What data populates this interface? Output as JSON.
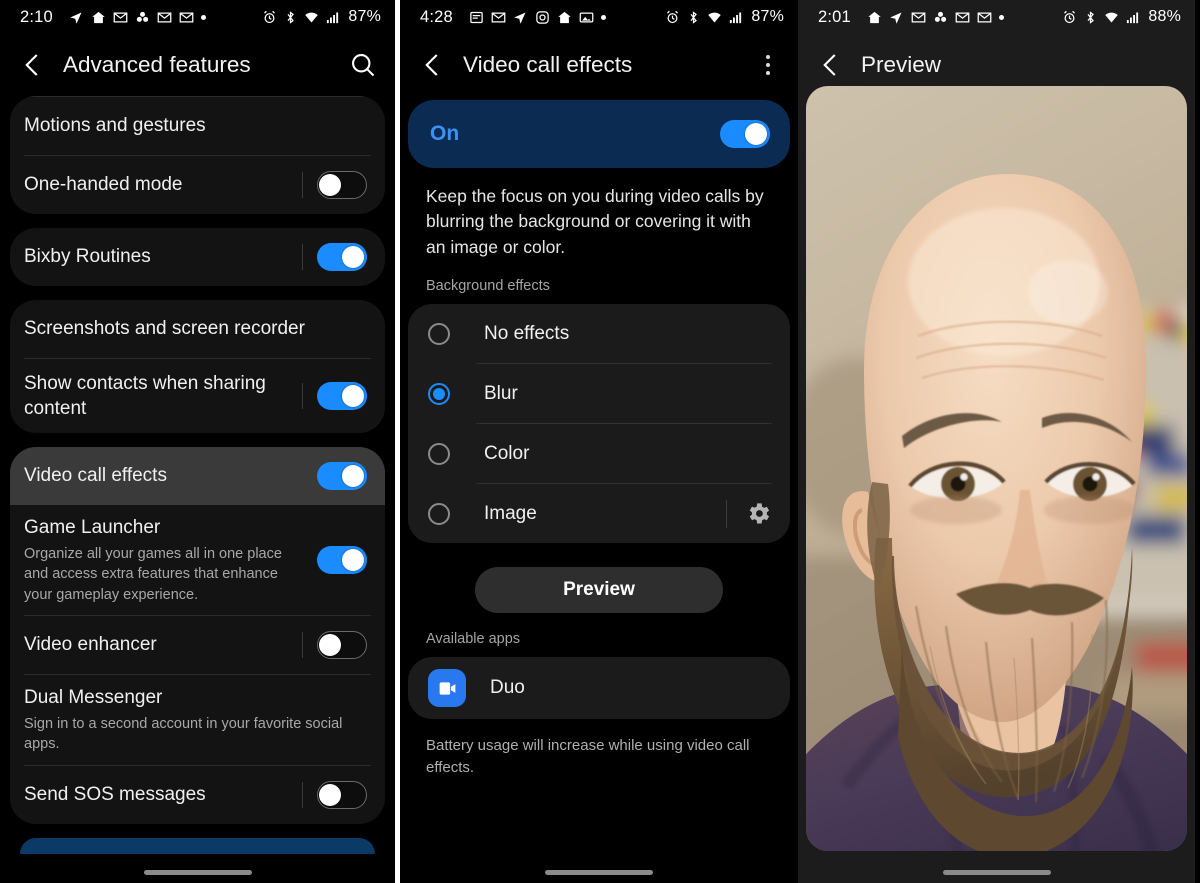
{
  "panels": [
    {
      "status_bar": {
        "time": "2:10",
        "left_icons": [
          "send-icon",
          "home-icon",
          "gmail-icon",
          "flower-icon",
          "gmail-icon",
          "gmail-icon",
          "dot-icon"
        ],
        "right_icons": [
          "alarm-icon",
          "bluetooth-icon",
          "wifi-icon",
          "signal-icon"
        ],
        "battery": "87%"
      },
      "appbar": {
        "title": "Advanced features",
        "back": "back-icon",
        "action": "search-icon"
      },
      "cards": [
        {
          "rows": [
            {
              "title": "Motions and gestures",
              "sub": null,
              "toggle": null,
              "divider_after": true
            },
            {
              "title": "One-handed mode",
              "sub": null,
              "toggle": "off",
              "divider_after": false
            }
          ]
        },
        {
          "rows": [
            {
              "title": "Bixby Routines",
              "sub": null,
              "toggle": "on",
              "divider_after": false
            }
          ]
        },
        {
          "rows": [
            {
              "title": "Screenshots and screen recorder",
              "sub": null,
              "toggle": null,
              "divider_after": true
            },
            {
              "title": "Show contacts when sharing content",
              "sub": null,
              "toggle": "on",
              "divider_after": false
            }
          ]
        },
        {
          "rows": [
            {
              "title": "Video call effects",
              "sub": null,
              "toggle": "on",
              "divider_after": false,
              "highlight": true
            },
            {
              "title": "Game Launcher",
              "sub": "Organize all your games all in one place and access extra features that enhance your gameplay experience.",
              "toggle": "on",
              "divider_after": true
            },
            {
              "title": "Video enhancer",
              "sub": null,
              "toggle": "off",
              "divider_after": true
            },
            {
              "title": "Dual Messenger",
              "sub": "Sign in to a second account in your favorite social apps.",
              "toggle": null,
              "divider_after": true
            },
            {
              "title": "Send SOS messages",
              "sub": null,
              "toggle": "off",
              "divider_after": false
            }
          ]
        }
      ]
    },
    {
      "status_bar": {
        "time": "4:28",
        "left_icons": [
          "news-icon",
          "gmail-icon",
          "send-icon",
          "instagram-icon",
          "home-icon",
          "photos-icon",
          "dot-icon"
        ],
        "right_icons": [
          "alarm-icon",
          "bluetooth-icon",
          "wifi-icon",
          "signal-icon"
        ],
        "battery": "87%"
      },
      "appbar": {
        "title": "Video call effects",
        "back": "back-icon",
        "action": "more-options-icon"
      },
      "master_switch": {
        "label": "On",
        "state": "on"
      },
      "description": "Keep the focus on you during video calls by blurring the background or covering it with an image or color.",
      "background_effects": {
        "section_label": "Background effects",
        "options": [
          {
            "label": "No effects",
            "selected": false,
            "has_gear": false
          },
          {
            "label": "Blur",
            "selected": true,
            "has_gear": false
          },
          {
            "label": "Color",
            "selected": false,
            "has_gear": false
          },
          {
            "label": "Image",
            "selected": false,
            "has_gear": true
          }
        ]
      },
      "preview_button": "Preview",
      "available_apps": {
        "section_label": "Available apps",
        "apps": [
          {
            "name": "Duo",
            "icon": "video-camera-icon"
          }
        ]
      },
      "footer_note": "Battery usage will increase while using video call effects."
    },
    {
      "status_bar": {
        "time": "2:01",
        "left_icons": [
          "home-icon",
          "send-icon",
          "gmail-icon",
          "flower-icon",
          "gmail-icon",
          "gmail-icon",
          "dot-icon"
        ],
        "right_icons": [
          "alarm-icon",
          "bluetooth-icon",
          "wifi-icon",
          "signal-icon"
        ],
        "battery": "88%"
      },
      "appbar": {
        "title": "Preview",
        "back": "back-icon",
        "action": null
      },
      "preview_photo": {
        "alt": "Blurred-background selfie of a bald bearded man in a dark purple shirt in front of a toy shelf"
      }
    }
  ],
  "colors": {
    "accent_blue": "#1a8cff",
    "banner_bg": "#0c2b52",
    "banner_text": "#3d91f5",
    "card_bg": "#131313",
    "highlight_row": "#3a3a3a"
  }
}
